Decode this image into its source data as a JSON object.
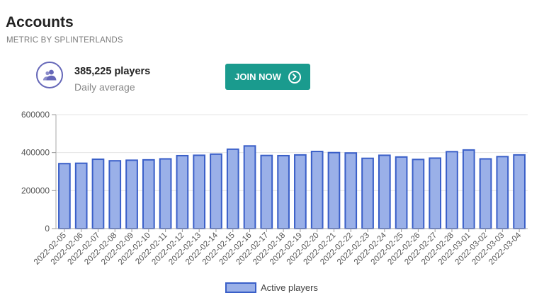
{
  "header": {
    "title": "Accounts",
    "subtitle": "METRIC BY SPLINTERLANDS"
  },
  "stat": {
    "icon": "users-icon",
    "value": "385,225 players",
    "label": "Daily average",
    "icon_color": "#6567b8"
  },
  "join_button": {
    "label": "JOIN NOW",
    "icon": "chevron-right-circle-icon",
    "color": "#1a9b8e"
  },
  "chart_data": {
    "type": "bar",
    "title": "",
    "xlabel": "",
    "ylabel": "",
    "ylim": [
      0,
      600000
    ],
    "yticks": [
      0,
      200000,
      400000,
      600000
    ],
    "grid": true,
    "legend_position": "bottom-center",
    "categories": [
      "2022-02-05",
      "2022-02-06",
      "2022-02-07",
      "2022-02-08",
      "2022-02-09",
      "2022-02-10",
      "2022-02-11",
      "2022-02-12",
      "2022-02-13",
      "2022-02-14",
      "2022-02-15",
      "2022-02-16",
      "2022-02-17",
      "2022-02-18",
      "2022-02-19",
      "2022-02-20",
      "2022-02-21",
      "2022-02-22",
      "2022-02-23",
      "2022-02-24",
      "2022-02-25",
      "2022-02-26",
      "2022-02-27",
      "2022-02-28",
      "2022-03-01",
      "2022-03-02",
      "2022-03-03",
      "2022-03-04"
    ],
    "series": [
      {
        "name": "Active players",
        "fill": "#9ab0e8",
        "stroke": "#3a5fc8",
        "values": [
          342000,
          344000,
          365000,
          357000,
          360000,
          362000,
          367000,
          384000,
          386000,
          392000,
          418000,
          435000,
          385000,
          384000,
          388000,
          406000,
          400000,
          398000,
          370000,
          386000,
          377000,
          364000,
          371000,
          405000,
          414000,
          367000,
          379000,
          388000
        ]
      }
    ]
  }
}
